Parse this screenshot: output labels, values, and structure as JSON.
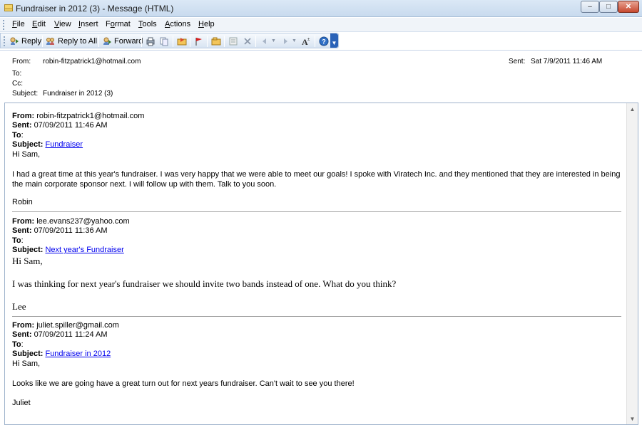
{
  "window": {
    "title": "Fundraiser in 2012 (3) - Message (HTML)",
    "minimize": "–",
    "maximize": "□",
    "close": "✕"
  },
  "menu": [
    {
      "acc": "F",
      "rest": "ile"
    },
    {
      "acc": "E",
      "rest": "dit"
    },
    {
      "acc": "V",
      "rest": "iew"
    },
    {
      "acc": "I",
      "rest": "nsert"
    },
    {
      "pre": "F",
      "acc": "o",
      "rest": "rmat"
    },
    {
      "acc": "T",
      "rest": "ools"
    },
    {
      "acc": "A",
      "rest": "ctions"
    },
    {
      "acc": "H",
      "rest": "elp"
    }
  ],
  "toolbar": {
    "reply_label": "Reply",
    "reply_all_label": "Reply to All",
    "forward_label": "Forward"
  },
  "header": {
    "from_label": "From:",
    "from_value": "robin-fitzpatrick1@hotmail.com",
    "to_label": "To:",
    "cc_label": "Cc:",
    "subject_label": "Subject:",
    "subject_value": "Fundraiser in 2012 (3)",
    "sent_label": "Sent:",
    "sent_value": "Sat 7/9/2011 11:46 AM"
  },
  "messages": [
    {
      "from": "robin-fitzpatrick1@hotmail.com",
      "sent": "07/09/2011 11:46 AM",
      "to": "",
      "subject": "Fundraiser",
      "greeting": "Hi Sam,",
      "body": "I had a great time at this year's fundraiser. I was very happy that we were able to meet our goals! I spoke with Viratech Inc. and they mentioned that they are interested in being the main corporate sponsor next. I will follow up with them. Talk to you soon.",
      "signature": "Robin"
    },
    {
      "from": "lee.evans237@yahoo.com",
      "sent": "07/09/2011 11:36 AM",
      "to": "",
      "subject": "Next year's Fundraiser",
      "greeting": "Hi Sam,",
      "body": "I was thinking for next year's fundraiser we should invite two bands instead of one. What do you think?",
      "signature": "Lee"
    },
    {
      "from": "juliet.spiller@gmail.com",
      "sent": "07/09/2011 11:24 AM",
      "to": "",
      "subject": "Fundraiser in 2012",
      "greeting": "Hi Sam,",
      "body": "Looks like we are going have a great turn out for next years fundraiser. Can't wait to see you there!",
      "signature": "Juliet"
    }
  ],
  "labels": {
    "from": "From:",
    "sent": "Sent:",
    "to": "To",
    "subject": "Subject:"
  }
}
